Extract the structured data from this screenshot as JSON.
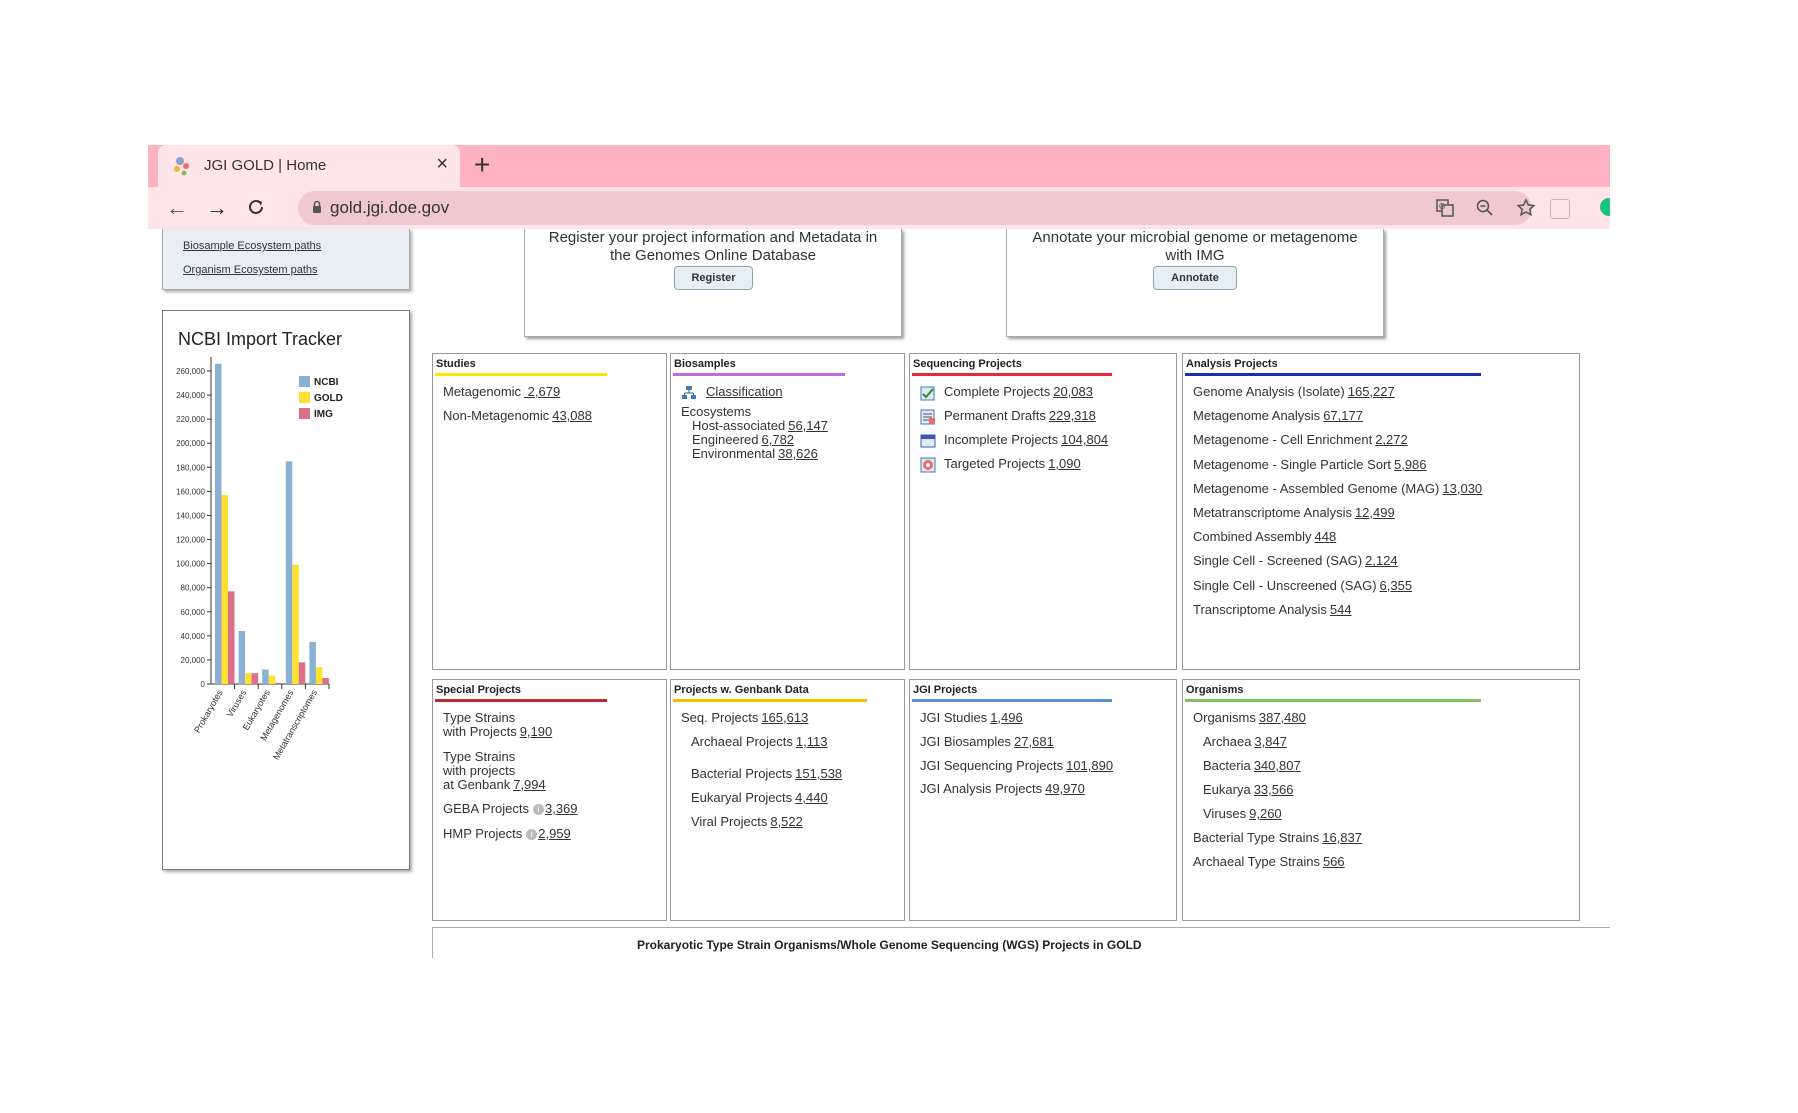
{
  "browser": {
    "tab_title": "JGI GOLD | Home",
    "close_glyph": "×",
    "new_tab_glyph": "+",
    "url": "gold.jgi.doe.gov",
    "back_glyph": "←",
    "forward_glyph": "→",
    "reload_glyph": "C",
    "translate_icon": "translate-icon",
    "zoom_icon": "zoom-out-icon",
    "star_icon": "star-icon",
    "tab_color": "#ffe4ea",
    "frame_color": "#ffb3c0"
  },
  "leftnav": {
    "links": [
      "Biosample Ecosystem paths",
      "Organism Ecosystem paths"
    ]
  },
  "register": {
    "text_line1": "Register your project information and Metadata in",
    "text_line2": "the Genomes Online Database",
    "button": "Register"
  },
  "annotate": {
    "text_line1": "Annotate your microbial genome or metagenome",
    "text_line2": "with IMG",
    "button": "Annotate"
  },
  "tracker": {
    "title": "NCBI Import Tracker"
  },
  "chart_data": {
    "type": "bar",
    "categories": [
      "Prokaryotes",
      "Viruses",
      "Eukaryotes",
      "Metagenomes",
      "Metatranscriptomes"
    ],
    "series": [
      {
        "name": "NCBI",
        "color": "#8ab0d4",
        "values": [
          266000,
          44000,
          12000,
          185000,
          35000
        ]
      },
      {
        "name": "GOLD",
        "color": "#ffe033",
        "values": [
          157000,
          9000,
          7000,
          99000,
          14000
        ]
      },
      {
        "name": "IMG",
        "color": "#dd6f88",
        "values": [
          77000,
          9000,
          1000,
          18000,
          5000
        ]
      }
    ],
    "yticks": [
      "0",
      "20,000",
      "40,000",
      "60,000",
      "80,000",
      "100,000",
      "120,000",
      "140,000",
      "160,000",
      "180,000",
      "200,000",
      "220,000",
      "240,000",
      "260,000"
    ],
    "ylim": [
      0,
      260000
    ],
    "legend_position": "top-right"
  },
  "panels": {
    "studies": {
      "title": "Studies",
      "color": "#ffe600",
      "rows": [
        {
          "label": "Metagenomic",
          "value": " 2,679"
        },
        {
          "label": "Non-Metagenomic",
          "value": "43,088"
        }
      ]
    },
    "biosamples": {
      "title": "Biosamples",
      "color": "#c26be0",
      "classification": "Classification",
      "ecosystems": "Ecosystems",
      "rows": [
        {
          "label": "Host-associated",
          "value": "56,147"
        },
        {
          "label": "Engineered",
          "value": "6,782"
        },
        {
          "label": "Environmental",
          "value": "38,626"
        }
      ]
    },
    "sequencing": {
      "title": "Sequencing Projects",
      "color": "#e8283c",
      "rows": [
        {
          "label": "Complete Projects",
          "value": "20,083",
          "icon": "complete-icon"
        },
        {
          "label": "Permanent Drafts",
          "value": "229,318",
          "icon": "draft-icon"
        },
        {
          "label": "Incomplete Projects",
          "value": "104,804",
          "icon": "incomplete-icon"
        },
        {
          "label": "Targeted Projects",
          "value": "1,090",
          "icon": "target-icon"
        }
      ]
    },
    "analysis": {
      "title": "Analysis Projects",
      "color": "#1c2fb3",
      "rows": [
        {
          "label": "Genome Analysis (Isolate)",
          "value": "165,227"
        },
        {
          "label": "Metagenome Analysis",
          "value": "67,177"
        },
        {
          "label": "Metagenome - Cell Enrichment",
          "value": "2,272"
        },
        {
          "label": "Metagenome - Single Particle Sort",
          "value": "5,986"
        },
        {
          "label": "Metagenome - Assembled Genome (MAG)",
          "value": "13,030"
        },
        {
          "label": "Metatranscriptome Analysis",
          "value": "12,499"
        },
        {
          "label": "Combined Assembly",
          "value": "448"
        },
        {
          "label": "Single Cell - Screened (SAG)",
          "value": "2,124"
        },
        {
          "label": "Single Cell - Unscreened (SAG)",
          "value": "6,355"
        },
        {
          "label": "Transcriptome Analysis",
          "value": "544"
        }
      ]
    },
    "special": {
      "title": "Special Projects",
      "color": "#c0282c",
      "type_strains_line1": "Type Strains",
      "type_strains_line2": "with Projects",
      "type_strains_value": "9,190",
      "genbank_line1": "Type Strains",
      "genbank_line2": "with projects",
      "genbank_line3": "at Genbank",
      "genbank_value": "7,994",
      "geba_label": "GEBA Projects",
      "geba_value": "3,369",
      "hmp_label": "HMP Projects",
      "hmp_value": "2,959",
      "info_glyph": "i"
    },
    "genbank": {
      "title": "Projects w. Genbank Data",
      "color": "#f2c200",
      "rows": [
        {
          "label": "Seq. Projects",
          "value": "165,613"
        },
        {
          "label": "Archaeal Projects",
          "value": "1,113"
        },
        {
          "label": "Bacterial Projects",
          "value": "151,538"
        },
        {
          "label": "Eukaryal Projects",
          "value": "4,440"
        },
        {
          "label": "Viral Projects",
          "value": "8,522"
        }
      ]
    },
    "jgi": {
      "title": "JGI Projects",
      "color": "#5a8fdc",
      "rows": [
        {
          "label": "JGI Studies",
          "value": "1,496"
        },
        {
          "label": "JGI Biosamples",
          "value": "27,681"
        },
        {
          "label": "JGI Sequencing Projects",
          "value": "101,890"
        },
        {
          "label": "JGI Analysis Projects",
          "value": "49,970"
        }
      ]
    },
    "organisms": {
      "title": "Organisms",
      "color": "#7fc064",
      "rows": [
        {
          "label": "Organisms",
          "value": "387,480"
        },
        {
          "label": "Archaea",
          "value": "3,847"
        },
        {
          "label": "Bacteria",
          "value": "340,807"
        },
        {
          "label": "Eukarya",
          "value": "33,566"
        },
        {
          "label": "Viruses",
          "value": "9,260"
        },
        {
          "label": "Bacterial Type Strains",
          "value": "16,837"
        },
        {
          "label": "Archaeal Type Strains",
          "value": "566"
        }
      ]
    }
  },
  "footer": {
    "title": "Prokaryotic Type Strain Organisms/Whole Genome Sequencing (WGS) Projects in GOLD"
  }
}
